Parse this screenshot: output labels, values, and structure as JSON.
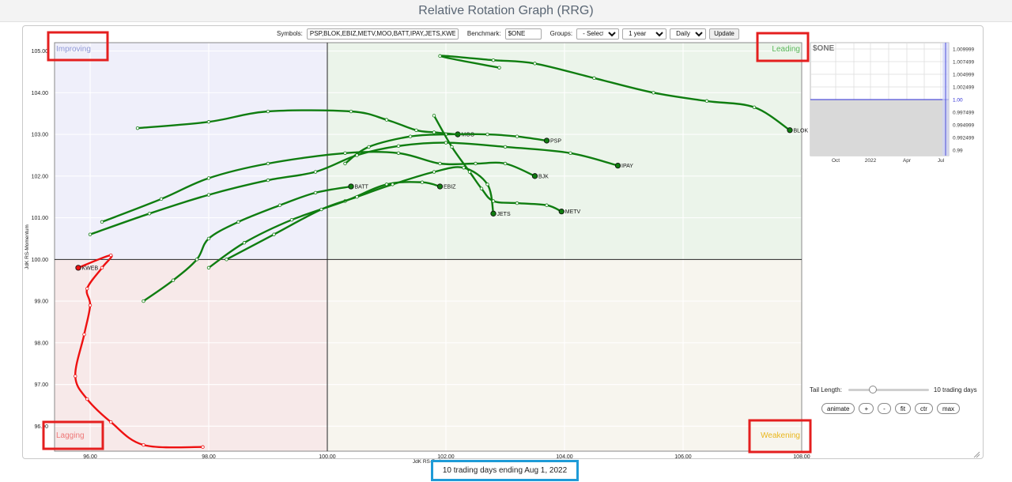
{
  "page": {
    "title": "Relative Rotation Graph (RRG)"
  },
  "toolbar": {
    "symbols_label": "Symbols:",
    "symbols_value": "PSP,BLOK,EBIZ,METV,MOO,BATT,IPAY,JETS,KWEB",
    "benchmark_label": "Benchmark:",
    "benchmark_value": "$ONE",
    "groups_label": "Groups:",
    "groups_selected": "- Select -",
    "period_selected": "1 year",
    "frequency_selected": "Daily",
    "update_label": "Update"
  },
  "quadrants": {
    "improving": "Improving",
    "leading": "Leading",
    "weakening": "Weakening",
    "lagging": "Lagging"
  },
  "colors": {
    "improving_bg": "#efeffa",
    "leading_bg": "#ebf4ea",
    "weakening_bg": "#f7f5ee",
    "lagging_bg": "#f7e9e9",
    "improving_text": "#9099d6",
    "leading_text": "#5cb85c",
    "weakening_text": "#e9b61c",
    "lagging_text": "#ee7777",
    "series_green": "#0f7d10",
    "series_red": "#ee1111",
    "highlight_red": "#e41f1f",
    "highlight_blue": "#1e9bd7"
  },
  "chart_data": {
    "type": "scatter",
    "title": "",
    "xlabel": "JdK RS-Ratio",
    "ylabel": "JdK RS-Momentum",
    "xlim": [
      95.4,
      108.0
    ],
    "ylim": [
      95.4,
      105.2
    ],
    "x_ticks": [
      "96.00",
      "98.00",
      "100.00",
      "102.00",
      "104.00",
      "106.00",
      "108.00"
    ],
    "y_ticks": [
      "105.00",
      "104.00",
      "103.00",
      "102.00",
      "101.00",
      "100.00",
      "99.00",
      "98.00",
      "97.00",
      "96.00"
    ],
    "grid": true,
    "center": [
      100,
      100
    ],
    "series": [
      {
        "name": "BLOK",
        "color": "#0f7d10",
        "x": [
          102.9,
          101.9,
          102.8,
          103.5,
          104.5,
          105.5,
          106.4,
          107.2,
          107.8
        ],
        "y": [
          104.6,
          104.88,
          104.78,
          104.7,
          104.35,
          104.0,
          103.8,
          103.65,
          103.1
        ]
      },
      {
        "name": "MOO",
        "color": "#0f7d10",
        "x": [
          96.8,
          98.0,
          99.0,
          100.4,
          101.0,
          101.5,
          101.8,
          102.2
        ],
        "y": [
          103.15,
          103.3,
          103.55,
          103.55,
          103.35,
          103.1,
          103.05,
          103.0
        ]
      },
      {
        "name": "PSP",
        "color": "#0f7d10",
        "x": [
          100.3,
          100.7,
          101.4,
          102.0,
          102.7,
          103.2,
          103.7
        ],
        "y": [
          102.3,
          102.7,
          102.95,
          103.0,
          103.0,
          102.95,
          102.85
        ]
      },
      {
        "name": "IPAY",
        "color": "#0f7d10",
        "x": [
          96.0,
          97.0,
          98.0,
          99.0,
          99.8,
          100.5,
          101.2,
          102.0,
          103.0,
          104.1,
          104.9
        ],
        "y": [
          100.6,
          101.1,
          101.55,
          101.9,
          102.1,
          102.5,
          102.72,
          102.8,
          102.7,
          102.55,
          102.25
        ]
      },
      {
        "name": "BJK",
        "color": "#0f7d10",
        "x": [
          96.2,
          97.2,
          98.0,
          99.0,
          100.3,
          101.2,
          101.9,
          102.5,
          103.0,
          103.5
        ],
        "y": [
          100.9,
          101.45,
          101.95,
          102.3,
          102.55,
          102.55,
          102.3,
          102.3,
          102.3,
          102.0
        ]
      },
      {
        "name": "BATT",
        "color": "#0f7d10",
        "x": [
          96.9,
          97.4,
          97.8,
          98.0,
          98.5,
          99.2,
          99.8,
          100.4
        ],
        "y": [
          99.0,
          99.5,
          100.0,
          100.5,
          100.9,
          101.3,
          101.6,
          101.75
        ]
      },
      {
        "name": "EBIZ",
        "color": "#0f7d10",
        "x": [
          98.0,
          98.6,
          99.4,
          100.3,
          101.0,
          101.6,
          101.9
        ],
        "y": [
          99.8,
          100.4,
          100.95,
          101.4,
          101.8,
          101.85,
          101.75
        ]
      },
      {
        "name": "JETS",
        "color": "#0f7d10",
        "x": [
          98.3,
          99.1,
          99.9,
          100.5,
          101.1,
          101.8,
          102.3,
          102.7,
          102.8
        ],
        "y": [
          100.0,
          100.6,
          101.2,
          101.5,
          101.8,
          102.1,
          102.2,
          101.8,
          101.1
        ]
      },
      {
        "name": "METV",
        "color": "#0f7d10",
        "x": [
          101.8,
          102.1,
          102.4,
          102.6,
          102.8,
          103.2,
          103.7,
          103.95
        ],
        "y": [
          103.45,
          102.7,
          102.1,
          101.7,
          101.4,
          101.35,
          101.3,
          101.15
        ]
      },
      {
        "name": "KWEB",
        "color": "#ee1111",
        "x": [
          97.9,
          96.9,
          96.35,
          95.95,
          95.75,
          95.9,
          96.0,
          95.95,
          96.2,
          96.35,
          95.8
        ],
        "y": [
          95.5,
          95.55,
          96.1,
          96.65,
          97.2,
          98.2,
          98.9,
          99.3,
          99.8,
          100.1,
          99.8
        ]
      }
    ]
  },
  "mini_chart": {
    "title": "$ONE",
    "y_ticks": [
      "1.009999",
      "1.007499",
      "1.004999",
      "1.002499",
      "1.00",
      "0.997499",
      "0.994999",
      "0.992499",
      "0.99"
    ],
    "x_ticks": [
      "Oct",
      "2022",
      "Apr",
      "Jul"
    ]
  },
  "controls": {
    "tail_length_label": "Tail Length:",
    "tail_length_value": "10 trading days",
    "tail_length_fraction": 0.28,
    "buttons": [
      "animate",
      "+",
      "-",
      "fit",
      "ctr",
      "max"
    ]
  },
  "footer": {
    "status": "10 trading days ending Aug 1, 2022"
  }
}
